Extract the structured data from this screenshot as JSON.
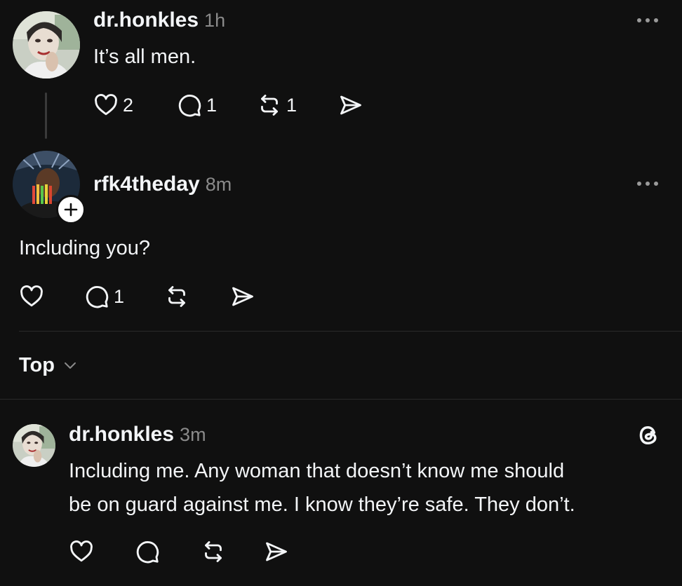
{
  "post1": {
    "username": "dr.honkles",
    "time": "1h",
    "text": "It’s all men.",
    "likes": "2",
    "replies": "1",
    "reposts": "1"
  },
  "post2": {
    "username": "rfk4theday",
    "time": "8m",
    "text": "Including you?",
    "replies": "1"
  },
  "sort": {
    "label": "Top"
  },
  "reply": {
    "username": "dr.honkles",
    "time": "3m",
    "line1": "Including me. Any woman that doesn’t know me should",
    "line2": "be on guard against me. I know they’re safe. They don’t."
  }
}
